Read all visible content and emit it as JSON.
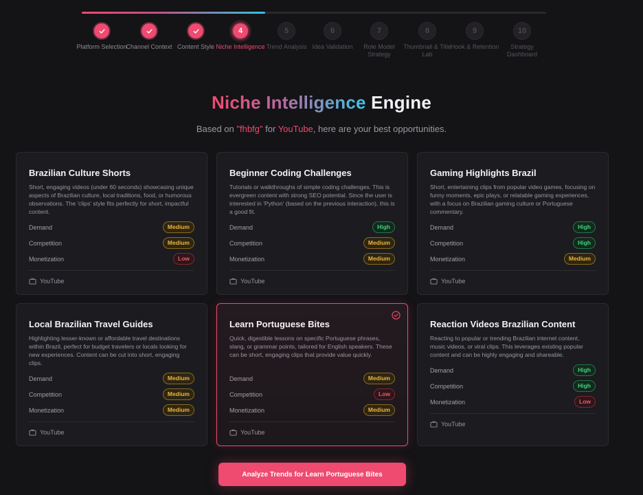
{
  "progress": {
    "fraction": 0.395
  },
  "steps": [
    {
      "number": "1",
      "label": "Platform Selection",
      "state": "done"
    },
    {
      "number": "2",
      "label": "Channel Context",
      "state": "done"
    },
    {
      "number": "3",
      "label": "Content Style",
      "state": "done"
    },
    {
      "number": "4",
      "label": "Niche Intelligence",
      "state": "active"
    },
    {
      "number": "5",
      "label": "Trend Analysis",
      "state": "todo"
    },
    {
      "number": "6",
      "label": "Idea Validation",
      "state": "todo"
    },
    {
      "number": "7",
      "label": "Role Model Strategy",
      "state": "todo"
    },
    {
      "number": "8",
      "label": "Thumbnail & Title Lab",
      "state": "todo"
    },
    {
      "number": "9",
      "label": "Hook & Retention",
      "state": "todo"
    },
    {
      "number": "10",
      "label": "Strategy Dashboard",
      "state": "todo"
    }
  ],
  "header": {
    "title_gradient": "Niche Intelligence",
    "title_plain": "Engine",
    "subtitle_prefix": "Based on ",
    "subtitle_query": "\"fhbfg\"",
    "subtitle_mid": " for ",
    "subtitle_platform": "YouTube",
    "subtitle_suffix": ", here are your best opportunities."
  },
  "metric_labels": {
    "demand": "Demand",
    "competition": "Competition",
    "monetization": "Monetization"
  },
  "cards": [
    {
      "title": "Brazilian Culture Shorts",
      "description": "Short, engaging videos (under 60 seconds) showcasing unique aspects of Brazilian culture, local traditions, food, or humorous observations. The 'clips' style fits perfectly for short, impactful content.",
      "demand": "Medium",
      "competition": "Medium",
      "monetization": "Low",
      "platform": "YouTube",
      "selected": false
    },
    {
      "title": "Beginner Coding Challenges",
      "description": "Tutorials or walkthroughs of simple coding challenges. This is evergreen content with strong SEO potential. Since the user is interested in 'Python' (based on the previous interaction), this is a good fit.",
      "demand": "High",
      "competition": "Medium",
      "monetization": "Medium",
      "platform": "YouTube",
      "selected": false
    },
    {
      "title": "Gaming Highlights Brazil",
      "description": "Short, entertaining clips from popular video games, focusing on funny moments, epic plays, or relatable gaming experiences, with a focus on Brazilian gaming culture or Portuguese commentary.",
      "demand": "High",
      "competition": "High",
      "monetization": "Medium",
      "platform": "YouTube",
      "selected": false
    },
    {
      "title": "Local Brazilian Travel Guides",
      "description": "Highlighting lesser-known or affordable travel destinations within Brazil, perfect for budget travelers or locals looking for new experiences. Content can be cut into short, engaging clips.",
      "demand": "Medium",
      "competition": "Medium",
      "monetization": "Medium",
      "platform": "YouTube",
      "selected": false
    },
    {
      "title": "Learn Portuguese Bites",
      "description": "Quick, digestible lessons on specific Portuguese phrases, slang, or grammar points, tailored for English speakers. These can be short, engaging clips that provide value quickly.",
      "demand": "Medium",
      "competition": "Low",
      "monetization": "Medium",
      "platform": "YouTube",
      "selected": true
    },
    {
      "title": "Reaction Videos Brazilian Content",
      "description": "Reacting to popular or trending Brazilian internet content, music videos, or viral clips. This leverages existing popular content and can be highly engaging and shareable.",
      "demand": "High",
      "competition": "High",
      "monetization": "Low",
      "platform": "YouTube",
      "selected": false
    }
  ],
  "cta": {
    "label": "Analyze Trends for Learn Portuguese Bites"
  },
  "colors": {
    "accent": "#ef4a70",
    "medium": "#f0b43a",
    "high": "#3fd27f",
    "low": "#ef5a68"
  },
  "icons": {
    "done_step": "check-icon",
    "platform": "tv-icon",
    "selected_card": "check-circle-icon"
  }
}
